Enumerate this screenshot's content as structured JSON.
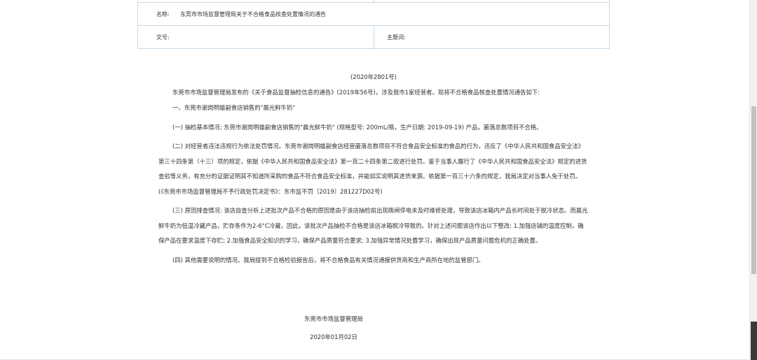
{
  "meta": {
    "name_label": "名称:",
    "name_value": "东莞市市场监督管理局关于不合格食品核查处置情况的通告",
    "docno_label": "文号:",
    "docno_value": "",
    "subject_label": "主题词:",
    "subject_value": ""
  },
  "document": {
    "number": "(2020年2801号)",
    "intro": "东莞市市场监督管理局发布的《关于食品监督抽检信息的通告》(2019年56号)，涉及我市1家经营者。现将不合格食品核查处置情况通告如下:",
    "section_heading": "一、东莞市谢岗明雄副食店销售的\"晨光鲜牛奶\"",
    "para1": "(一) 抽检基本情况: 东莞市谢岗明雄副食店销售的\"晨光鲜牛奶\" (规格型号: 200mL/瓶，生产日期: 2019-09-19) 产品，菌落总数项目不合格。",
    "para2": "(二) 对经营者违法违规行为依法处罚情况。东莞市谢岗明雄副食店经营菌落总数项目不符合食品安全标准的食品的行为，违反了《中华人民共和国食品安全法》第三十四条第（十三）项的规定，依据《中华人民共和国食品安全法》第一百二十四条第二款进行处罚。鉴于当事人履行了《中华人民共和国食品安全法》规定的进货查验等义务，有充分的证据证明其不知道所采购的食品不符合食品安全标准，并能如实说明其进货来源。依据第一百三十六条的规定，我局决定对当事人免于处罚。(《东莞市市场监督管理局不予行政处罚决定书》：东市监不罚〔2019〕281227D02号)",
    "para3": "(三) 原因排查情况: 该店自查分析上述批次产品不合格的原因是由于该店抽检前出现跳闸停电未及时维修处理，导致该店冰箱内产品长时间处于脱冷状态。而晨光鲜牛奶为低温冷藏产品，贮存条件为2-6°C冷藏，因此，该批次产品抽检不合格是该店冰箱脱冷导致的。针对上述问题该店作出以下整改: 1.加强店铺的温度控制，确保产品在要求温度下存贮; 2.加强食品安全知识的学习，确保产品质量符合要求; 3.加强异常情况处置学习，确保出现产品质量问题危机的正确处置。",
    "para4": "(四) 其他需要说明的情况。我局接到不合格检验报告后，将不合格食品有关情况通报供货商和生产商所在地的监管部门。",
    "issuer": "东莞市市场监督管理局",
    "date": "2020年01月02日"
  }
}
